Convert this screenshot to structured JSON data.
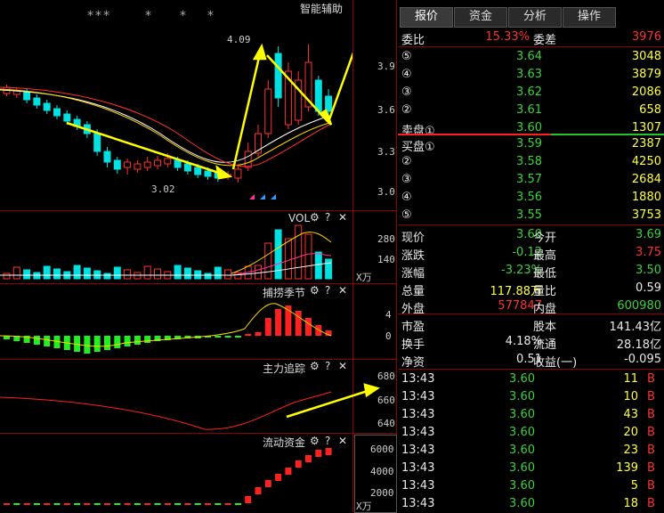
{
  "header": {
    "indicator": "智能辅助",
    "stars": [
      "***",
      "*",
      "*",
      "*"
    ]
  },
  "main_chart": {
    "y_axis": [
      "3.9",
      "3.6",
      "3.3",
      "3.0"
    ],
    "high_marker": "4.09",
    "low_marker": "3.02"
  },
  "vol_panel": {
    "title": "VOL",
    "y_axis": [
      "280",
      "140"
    ],
    "unit": "X万"
  },
  "panel2": {
    "title": "捕捞季节",
    "y_axis": [
      "4",
      "0"
    ]
  },
  "panel3": {
    "title": "主力追踪",
    "y_axis": [
      "680",
      "660",
      "640"
    ]
  },
  "panel4": {
    "title": "流动资金",
    "y_axis": [
      "6000",
      "4000",
      "2000"
    ],
    "unit": "X万"
  },
  "controls": {
    "gear": "⚙",
    "help": "?",
    "close": "✕"
  },
  "tabs": [
    "报价",
    "资金",
    "分析",
    "操作"
  ],
  "quote": {
    "weibi_label": "委比",
    "weibi_value": "15.33%",
    "weicha_label": "委差",
    "weicha_value": "3976",
    "asks": [
      {
        "label": "⑤",
        "price": "3.64",
        "vol": "3048"
      },
      {
        "label": "④",
        "price": "3.63",
        "vol": "3879"
      },
      {
        "label": "③",
        "price": "3.62",
        "vol": "2086"
      },
      {
        "label": "②",
        "price": "3.61",
        "vol": "658"
      },
      {
        "label": "卖盘①",
        "price": "3.60",
        "vol": "1307"
      }
    ],
    "bids": [
      {
        "label": "买盘①",
        "price": "3.59",
        "vol": "2387"
      },
      {
        "label": "②",
        "price": "3.58",
        "vol": "4250"
      },
      {
        "label": "③",
        "price": "3.57",
        "vol": "2684"
      },
      {
        "label": "④",
        "price": "3.56",
        "vol": "1880"
      },
      {
        "label": "⑤",
        "price": "3.55",
        "vol": "3753"
      }
    ],
    "stats": [
      {
        "l1": "现价",
        "v1": "3.60",
        "c1": "green",
        "l2": "今开",
        "v2": "3.69",
        "c2": "green"
      },
      {
        "l1": "涨跌",
        "v1": "-0.12",
        "c1": "green",
        "l2": "最高",
        "v2": "3.75",
        "c2": "red"
      },
      {
        "l1": "涨幅",
        "v1": "-3.23%",
        "c1": "green",
        "l2": "最低",
        "v2": "3.50",
        "c2": "green"
      },
      {
        "l1": "总量",
        "v1": "117.88万",
        "c1": "yellow",
        "l2": "量比",
        "v2": "0.59",
        "c2": "white"
      },
      {
        "l1": "外盘",
        "v1": "577847",
        "c1": "red",
        "l2": "内盘",
        "v2": "600980",
        "c2": "green"
      }
    ],
    "stats2": [
      {
        "l1": "市盈",
        "v1": "-",
        "c1": "white",
        "l2": "股本",
        "v2": "141.43亿",
        "c2": "white"
      },
      {
        "l1": "换手",
        "v1": "4.18%",
        "c1": "white",
        "l2": "流通",
        "v2": "28.18亿",
        "c2": "white"
      },
      {
        "l1": "净资",
        "v1": "0.51",
        "c1": "white",
        "l2": "收益(一)",
        "v2": "-0.095",
        "c2": "white"
      }
    ],
    "ticks": [
      {
        "time": "13:43",
        "price": "3.60",
        "vol": "11",
        "bs": "B"
      },
      {
        "time": "13:43",
        "price": "3.60",
        "vol": "10",
        "bs": "B"
      },
      {
        "time": "13:43",
        "price": "3.60",
        "vol": "43",
        "bs": "B"
      },
      {
        "time": "13:43",
        "price": "3.60",
        "vol": "20",
        "bs": "B"
      },
      {
        "time": "13:43",
        "price": "3.60",
        "vol": "23",
        "bs": "B"
      },
      {
        "time": "13:43",
        "price": "3.60",
        "vol": "139",
        "bs": "B"
      },
      {
        "time": "13:43",
        "price": "3.60",
        "vol": "5",
        "bs": "B"
      },
      {
        "time": "13:43",
        "price": "3.60",
        "vol": "18",
        "bs": "B"
      }
    ]
  },
  "colors": {
    "up": "#ff3030",
    "down": "#00e0e0",
    "grid": "#8b0000",
    "arrow": "#ffff00"
  }
}
